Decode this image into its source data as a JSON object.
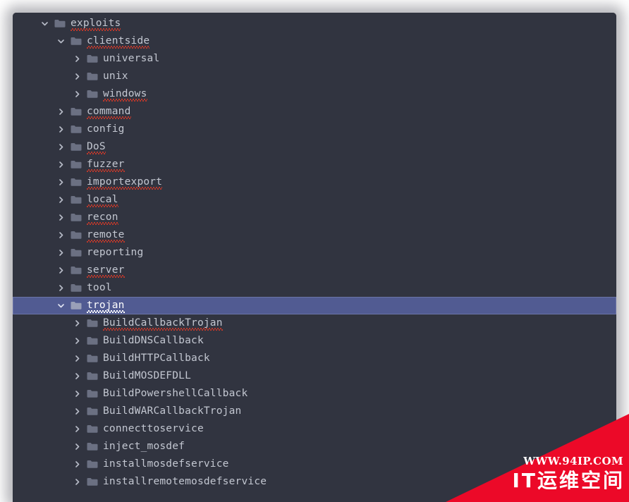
{
  "panel": {
    "background_color": "#313440",
    "selection_color": "#515b92",
    "text_color": "#c3c7d1",
    "folder_icon_color": "#6b7082",
    "spellcheck_underline_color": "#c0392b"
  },
  "tree": {
    "rows": [
      {
        "label": "exploits",
        "depth": 0,
        "state": "expanded",
        "icon": "chevron-down-icon",
        "folder": "folder-icon",
        "misspelled": true,
        "selected": false
      },
      {
        "label": "clientside",
        "depth": 1,
        "state": "expanded",
        "icon": "chevron-down-icon",
        "folder": "folder-icon",
        "misspelled": true,
        "selected": false
      },
      {
        "label": "universal",
        "depth": 2,
        "state": "collapsed",
        "icon": "chevron-right-icon",
        "folder": "folder-icon",
        "misspelled": false,
        "selected": false
      },
      {
        "label": "unix",
        "depth": 2,
        "state": "collapsed",
        "icon": "chevron-right-icon",
        "folder": "folder-icon",
        "misspelled": false,
        "selected": false
      },
      {
        "label": "windows",
        "depth": 2,
        "state": "collapsed",
        "icon": "chevron-right-icon",
        "folder": "folder-icon",
        "misspelled": true,
        "selected": false
      },
      {
        "label": "command",
        "depth": 1,
        "state": "collapsed",
        "icon": "chevron-right-icon",
        "folder": "folder-icon",
        "misspelled": true,
        "selected": false
      },
      {
        "label": "config",
        "depth": 1,
        "state": "collapsed",
        "icon": "chevron-right-icon",
        "folder": "folder-icon",
        "misspelled": false,
        "selected": false
      },
      {
        "label": "DoS",
        "depth": 1,
        "state": "collapsed",
        "icon": "chevron-right-icon",
        "folder": "folder-icon",
        "misspelled": true,
        "selected": false
      },
      {
        "label": "fuzzer",
        "depth": 1,
        "state": "collapsed",
        "icon": "chevron-right-icon",
        "folder": "folder-icon",
        "misspelled": true,
        "selected": false
      },
      {
        "label": "importexport",
        "depth": 1,
        "state": "collapsed",
        "icon": "chevron-right-icon",
        "folder": "folder-icon",
        "misspelled": true,
        "selected": false
      },
      {
        "label": "local",
        "depth": 1,
        "state": "collapsed",
        "icon": "chevron-right-icon",
        "folder": "folder-icon",
        "misspelled": true,
        "selected": false
      },
      {
        "label": "recon",
        "depth": 1,
        "state": "collapsed",
        "icon": "chevron-right-icon",
        "folder": "folder-icon",
        "misspelled": true,
        "selected": false
      },
      {
        "label": "remote",
        "depth": 1,
        "state": "collapsed",
        "icon": "chevron-right-icon",
        "folder": "folder-icon",
        "misspelled": true,
        "selected": false
      },
      {
        "label": "reporting",
        "depth": 1,
        "state": "collapsed",
        "icon": "chevron-right-icon",
        "folder": "folder-icon",
        "misspelled": false,
        "selected": false
      },
      {
        "label": "server",
        "depth": 1,
        "state": "collapsed",
        "icon": "chevron-right-icon",
        "folder": "folder-icon",
        "misspelled": true,
        "selected": false
      },
      {
        "label": "tool",
        "depth": 1,
        "state": "collapsed",
        "icon": "chevron-right-icon",
        "folder": "folder-icon",
        "misspelled": false,
        "selected": false
      },
      {
        "label": "trojan",
        "depth": 1,
        "state": "expanded",
        "icon": "chevron-down-icon",
        "folder": "folder-icon",
        "misspelled": true,
        "selected": true
      },
      {
        "label": "BuildCallbackTrojan",
        "depth": 2,
        "state": "collapsed",
        "icon": "chevron-right-icon",
        "folder": "folder-icon",
        "misspelled": true,
        "selected": false
      },
      {
        "label": "BuildDNSCallback",
        "depth": 2,
        "state": "collapsed",
        "icon": "chevron-right-icon",
        "folder": "folder-icon",
        "misspelled": false,
        "selected": false
      },
      {
        "label": "BuildHTTPCallback",
        "depth": 2,
        "state": "collapsed",
        "icon": "chevron-right-icon",
        "folder": "folder-icon",
        "misspelled": false,
        "selected": false
      },
      {
        "label": "BuildMOSDEFDLL",
        "depth": 2,
        "state": "collapsed",
        "icon": "chevron-right-icon",
        "folder": "folder-icon",
        "misspelled": false,
        "selected": false
      },
      {
        "label": "BuildPowershellCallback",
        "depth": 2,
        "state": "collapsed",
        "icon": "chevron-right-icon",
        "folder": "folder-icon",
        "misspelled": false,
        "selected": false
      },
      {
        "label": "BuildWARCallbackTrojan",
        "depth": 2,
        "state": "collapsed",
        "icon": "chevron-right-icon",
        "folder": "folder-icon",
        "misspelled": false,
        "selected": false
      },
      {
        "label": "connecttoservice",
        "depth": 2,
        "state": "collapsed",
        "icon": "chevron-right-icon",
        "folder": "folder-icon",
        "misspelled": false,
        "selected": false
      },
      {
        "label": "inject_mosdef",
        "depth": 2,
        "state": "collapsed",
        "icon": "chevron-right-icon",
        "folder": "folder-icon",
        "misspelled": false,
        "selected": false
      },
      {
        "label": "installmosdefservice",
        "depth": 2,
        "state": "collapsed",
        "icon": "chevron-right-icon",
        "folder": "folder-icon",
        "misspelled": false,
        "selected": false
      },
      {
        "label": "installremotemosdefservice",
        "depth": 2,
        "state": "collapsed",
        "icon": "chevron-right-icon",
        "folder": "folder-icon",
        "misspelled": false,
        "selected": false
      }
    ]
  },
  "watermark": {
    "url": "WWW.94IP.COM",
    "site_name": "IT运维空间",
    "color": "#ec0928"
  }
}
